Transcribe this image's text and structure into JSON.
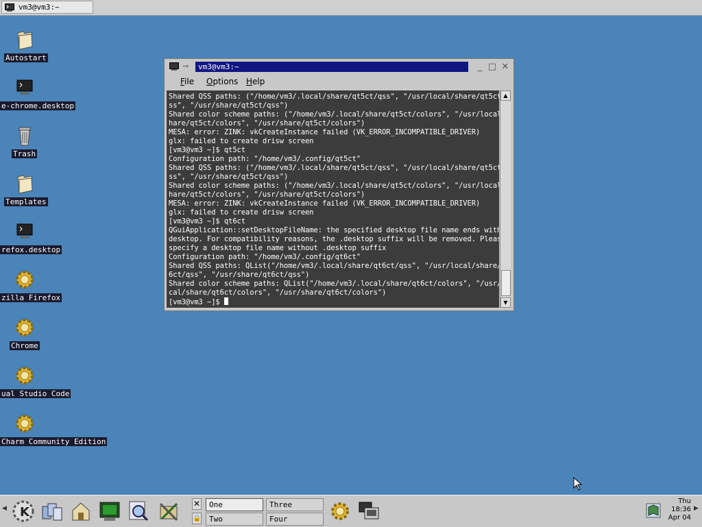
{
  "top_taskbar": {
    "task_title": "vm3@vm3:~"
  },
  "desktop_icons": [
    {
      "label": "Autostart",
      "icon": "folder-icon"
    },
    {
      "label": "e-chrome.desktop",
      "icon": "terminal-file-icon"
    },
    {
      "label": "Trash",
      "icon": "trash-icon"
    },
    {
      "label": "Templates",
      "icon": "folder-icon"
    },
    {
      "label": "refox.desktop",
      "icon": "terminal-file-icon"
    },
    {
      "label": "zilla Firefox",
      "icon": "gear-icon"
    },
    {
      "label": "Chrome",
      "icon": "gear-icon"
    },
    {
      "label": "ual Studio Code",
      "icon": "gear-icon"
    },
    {
      "label": "Charm Community Edition",
      "icon": "gear-icon"
    }
  ],
  "window": {
    "title": "vm3@vm3:~",
    "menu": [
      "File",
      "Options",
      "Help"
    ],
    "terminal_lines": [
      "Shared QSS paths: (\"/home/vm3/.local/share/qt5ct/qss\", \"/usr/local/share/qt5ct/q",
      "ss\", \"/usr/share/qt5ct/qss\")",
      "Shared color scheme paths: (\"/home/vm3/.local/share/qt5ct/colors\", \"/usr/local/s",
      "hare/qt5ct/colors\", \"/usr/share/qt5ct/colors\")",
      "MESA: error: ZINK: vkCreateInstance failed (VK_ERROR_INCOMPATIBLE_DRIVER)",
      "glx: failed to create drisw screen",
      "[vm3@vm3 ~]$ qt5ct",
      "Configuration path: \"/home/vm3/.config/qt5ct\"",
      "Shared QSS paths: (\"/home/vm3/.local/share/qt5ct/qss\", \"/usr/local/share/qt5ct/q",
      "ss\", \"/usr/share/qt5ct/qss\")",
      "Shared color scheme paths: (\"/home/vm3/.local/share/qt5ct/colors\", \"/usr/local/s",
      "hare/qt5ct/colors\", \"/usr/share/qt5ct/colors\")",
      "MESA: error: ZINK: vkCreateInstance failed (VK_ERROR_INCOMPATIBLE_DRIVER)",
      "glx: failed to create drisw screen",
      "[vm3@vm3 ~]$ qt6ct",
      "QGuiApplication::setDesktopFileName: the specified desktop file name ends with .",
      "desktop. For compatibility reasons, the .desktop suffix will be removed. Please",
      "specify a desktop file name without .desktop suffix",
      "Configuration path: \"/home/vm3/.config/qt6ct\"",
      "Shared QSS paths: QList(\"/home/vm3/.local/share/qt6ct/qss\", \"/usr/local/share/qt",
      "6ct/qss\", \"/usr/share/qt6ct/qss\")",
      "Shared color scheme paths: QList(\"/home/vm3/.local/share/qt6ct/colors\", \"/usr/lo",
      "cal/share/qt6ct/colors\", \"/usr/share/qt6ct/colors\")"
    ],
    "prompt": "[vm3@vm3 ~]$ "
  },
  "taskbar": {
    "launchers": [
      "kde-menu-icon",
      "windows-icon",
      "home-folder-icon",
      "terminal-icon",
      "search-icon",
      "tools-icon"
    ],
    "desktops": [
      {
        "label": "One",
        "active": true
      },
      {
        "label": "Two",
        "active": false
      },
      {
        "label": "Three",
        "active": false
      },
      {
        "label": "Four",
        "active": false
      }
    ],
    "clock": {
      "day": "Thu",
      "time": "18:36",
      "date": "Apr 04"
    }
  }
}
